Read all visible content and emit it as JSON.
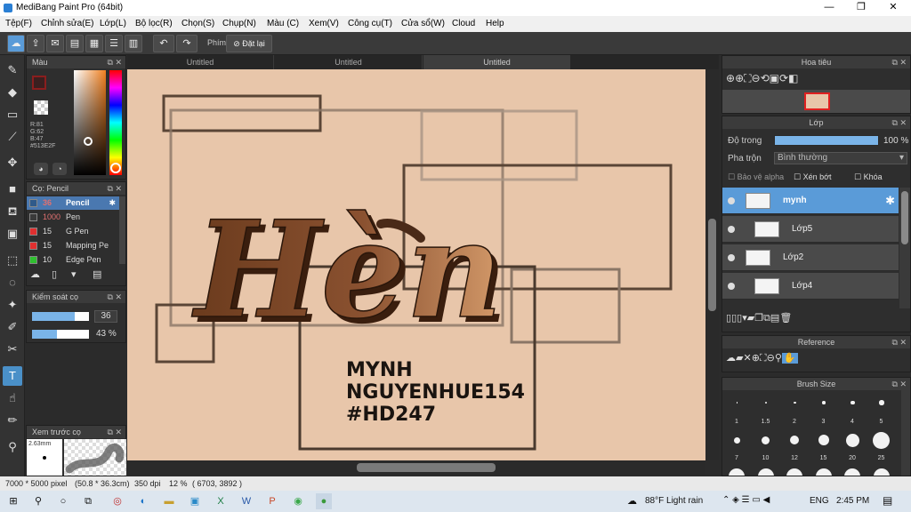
{
  "window": {
    "title": "MediBang Paint Pro (64bit)",
    "minimize": "—",
    "maximize": "❐",
    "close": "✕"
  },
  "menu": [
    "Tệp(F)",
    "Chỉnh sửa(E)",
    "Lớp(L)",
    "Bộ lọc(R)",
    "Chọn(S)",
    "Chụp(N)",
    "Màu (C)",
    "Xem(V)",
    "Công cụ(T)",
    "Cửa sổ(W)",
    "Cloud",
    "Help"
  ],
  "toolbar": {
    "phim_label": "Phím",
    "dat_lai_label": "Đặt lại"
  },
  "tabs": [
    "Untitled",
    "Untitled",
    "Untitled"
  ],
  "color_panel": {
    "title": "Màu",
    "r": "R:81",
    "g": "G:62",
    "b": "B:47",
    "hex": "#513E2F",
    "fg_color": "#8a1e1e"
  },
  "brush_panel": {
    "title": "Cọ: Pencil",
    "items": [
      {
        "size": "36",
        "name": "Pencil",
        "color": "#2f5a8a"
      },
      {
        "size": "1000",
        "name": "Pen",
        "color": "#3a3a3a"
      },
      {
        "size": "15",
        "name": "G Pen",
        "color": "#e03030"
      },
      {
        "size": "15",
        "name": "Mapping Pe",
        "color": "#e03030"
      },
      {
        "size": "10",
        "name": "Edge Pen",
        "color": "#30c030"
      }
    ]
  },
  "brush_control": {
    "title": "Kiểm soát cọ",
    "size_value": "36",
    "opacity_value": "43 %",
    "size_fill": 0.75,
    "opacity_fill": 0.43
  },
  "preview": {
    "title": "Xem trước cọ",
    "size_text": "2.63mm"
  },
  "navigator": {
    "title": "Hoa tiêu"
  },
  "layers_panel": {
    "title": "Lớp",
    "opacity_label": "Độ trong",
    "opacity_value": "100 %",
    "blend_label": "Pha trộn",
    "blend_value": "Bình thường",
    "protect_alpha": "Bảo vệ alpha",
    "clipping": "Xén bớt",
    "lock": "Khóa",
    "layers": [
      {
        "name": "mynh",
        "selected": true
      },
      {
        "name": "Lớp5",
        "selected": false
      },
      {
        "name": "Lớp2",
        "selected": false
      },
      {
        "name": "Lớp4",
        "selected": false
      }
    ]
  },
  "reference_panel": {
    "title": "Reference"
  },
  "brush_size_panel": {
    "title": "Brush Size",
    "row1": [
      "1",
      "1.5",
      "2",
      "3",
      "4",
      "5"
    ],
    "row2": [
      "7",
      "10",
      "12",
      "15",
      "20",
      "25"
    ]
  },
  "artwork": {
    "title_text": "Hèn",
    "lines": [
      "MYNH",
      "NGUYENHUE154",
      "#HD247"
    ],
    "text_color": "#1a1410"
  },
  "status": {
    "dimensions": "7000 * 5000 pixel",
    "size_cm": "(50.8 * 36.3cm)",
    "dpi": "350 dpi",
    "zoom": "12 %",
    "coords": "( 6703, 3892 )"
  },
  "taskbar": {
    "weather": "88°F  Light rain",
    "lang": "ENG",
    "time": "2:45 PM"
  }
}
